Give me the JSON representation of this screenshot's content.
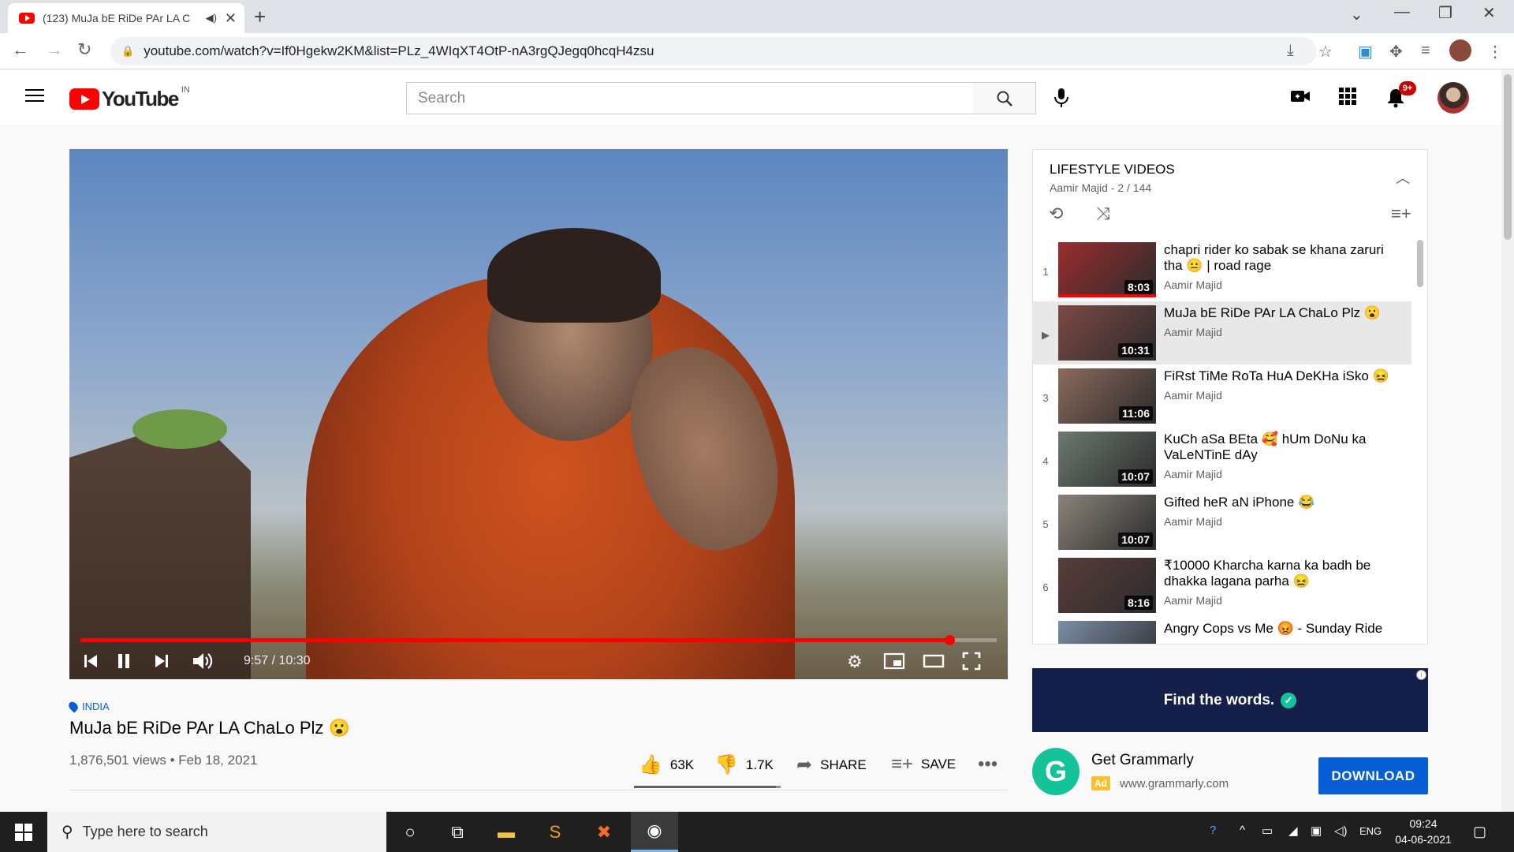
{
  "browser": {
    "tab_title": "(123) MuJa bE RiDe PAr LA C",
    "url": "youtube.com/watch?v=If0Hgekw2KM&list=PLz_4WIqXT4OtP-nA3rgQJegq0hcqH4zsu"
  },
  "masthead": {
    "logo_text": "YouTube",
    "country_code": "IN",
    "search_placeholder": "Search",
    "notification_count": "9+"
  },
  "player": {
    "current_time": "9:57",
    "duration": "10:30",
    "time_label": "9:57 / 10:30",
    "progress_fraction": 0.948,
    "buffered_fraction": 0.97
  },
  "video": {
    "location": "INDIA",
    "title": "MuJa bE RiDe PAr LA ChaLo Plz 😮",
    "meta": "1,876,501 views • Feb 18, 2021",
    "likes": "63K",
    "dislikes": "1.7K",
    "share_label": "SHARE",
    "save_label": "SAVE",
    "like_fraction": 0.97
  },
  "playlist": {
    "title": "LIFESTYLE VIDEOS",
    "subtitle": "Aamir Majid - 2 / 144",
    "items": [
      {
        "index": "1",
        "title": "chapri rider ko sabak se khana zaruri tha 😐 | road rage",
        "channel": "Aamir Majid",
        "duration": "8:03",
        "watched": 1.0,
        "thumb": "#9b2d2d"
      },
      {
        "index": "▶",
        "title": "MuJa bE RiDe PAr LA ChaLo Plz 😮",
        "channel": "Aamir Majid",
        "duration": "10:31",
        "watched": 0,
        "thumb": "#7d4a45"
      },
      {
        "index": "3",
        "title": "FiRst TiMe RoTa HuA DeKHa iSko 😖",
        "channel": "Aamir Majid",
        "duration": "11:06",
        "watched": 0,
        "thumb": "#8b6a5c"
      },
      {
        "index": "4",
        "title": "KuCh aSa BEta 🥰 hUm DoNu ka VaLeNTinE dAy",
        "channel": "Aamir Majid",
        "duration": "10:07",
        "watched": 0,
        "thumb": "#6b7a6e"
      },
      {
        "index": "5",
        "title": "Gifted heR aN iPhone 😂",
        "channel": "Aamir Majid",
        "duration": "10:07",
        "watched": 0,
        "thumb": "#8a8378"
      },
      {
        "index": "6",
        "title": "₹10000 Kharcha karna ka badh be dhakka lagana parha 😖",
        "channel": "Aamir Majid",
        "duration": "8:16",
        "watched": 0,
        "thumb": "#5a3d3a"
      },
      {
        "index": "",
        "title": "Angry Cops vs Me 😡 - Sunday Ride",
        "channel": "",
        "duration": "",
        "watched": 0,
        "thumb": "#7b8ea6"
      }
    ]
  },
  "ad": {
    "banner_text": "Find the words.",
    "brand_letter": "G",
    "name": "Get Grammarly",
    "tag": "Ad",
    "domain": "www.grammarly.com",
    "button": "DOWNLOAD",
    "info": "i"
  },
  "taskbar": {
    "search_placeholder": "Type here to search",
    "language": "ENG",
    "time": "09:24",
    "date": "04-06-2021"
  }
}
